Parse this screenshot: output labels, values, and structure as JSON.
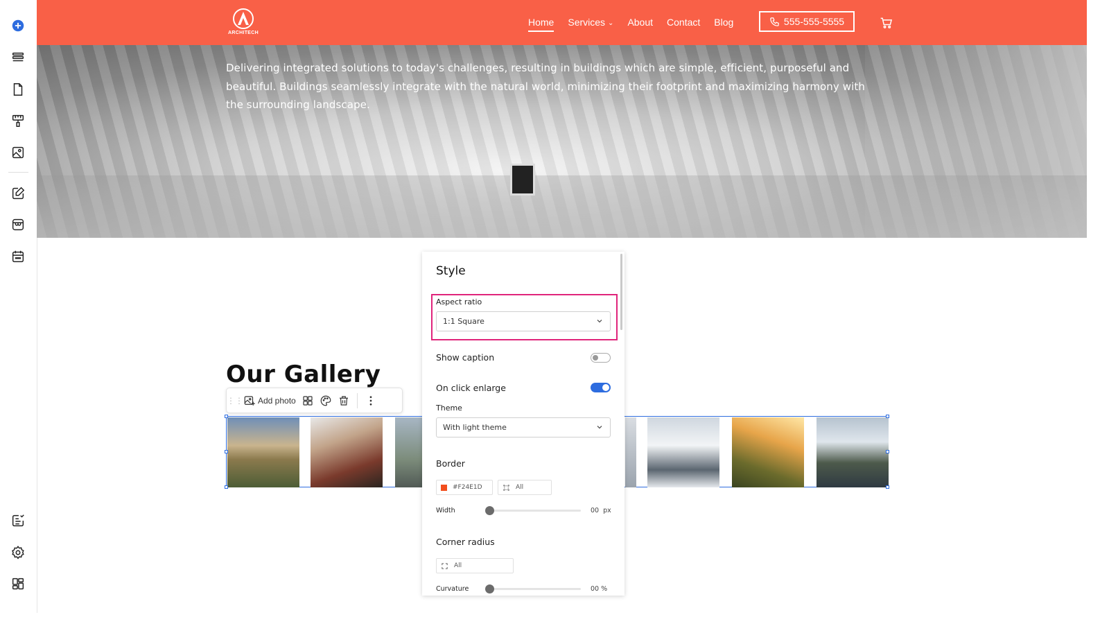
{
  "rail": {
    "icons": [
      "add-icon",
      "sections-icon",
      "pages-icon",
      "paint-roller-icon",
      "media-icon",
      "blog-edit-icon",
      "store-icon",
      "calendar-icon",
      "tasks-icon",
      "settings-icon",
      "apps-icon"
    ]
  },
  "header": {
    "logo_text": "ARCHITECH",
    "nav": [
      "Home",
      "Services",
      "About",
      "Contact",
      "Blog"
    ],
    "active_nav": "Home",
    "phone": "555-555-5555",
    "bg_color": "#F96047"
  },
  "hero": {
    "text": "Delivering integrated solutions to today's challenges, resulting in buildings which are simple, efficient, purposeful and beautiful. Buildings seamlessly integrate with the natural world, minimizing their footprint and maximizing harmony with the surrounding landscape."
  },
  "gallery": {
    "title": "Our Gallery",
    "toolbar": {
      "add_photo": "Add photo"
    }
  },
  "style_panel": {
    "title": "Style",
    "aspect_ratio_label": "Aspect ratio",
    "aspect_ratio_value": "1:1 Square",
    "show_caption_label": "Show caption",
    "show_caption_on": false,
    "on_click_enlarge_label": "On click enlarge",
    "on_click_enlarge_on": true,
    "theme_label": "Theme",
    "theme_value": "With light theme",
    "border_label": "Border",
    "border_color": "#F24E1D",
    "border_color_text": "#F24E1D",
    "border_sides": "All",
    "width_label": "Width",
    "width_value": "00",
    "width_unit": "px",
    "corner_radius_label": "Corner radius",
    "corner_sides": "All",
    "curvature_label": "Curvature",
    "curvature_value": "00",
    "curvature_unit": "%"
  }
}
